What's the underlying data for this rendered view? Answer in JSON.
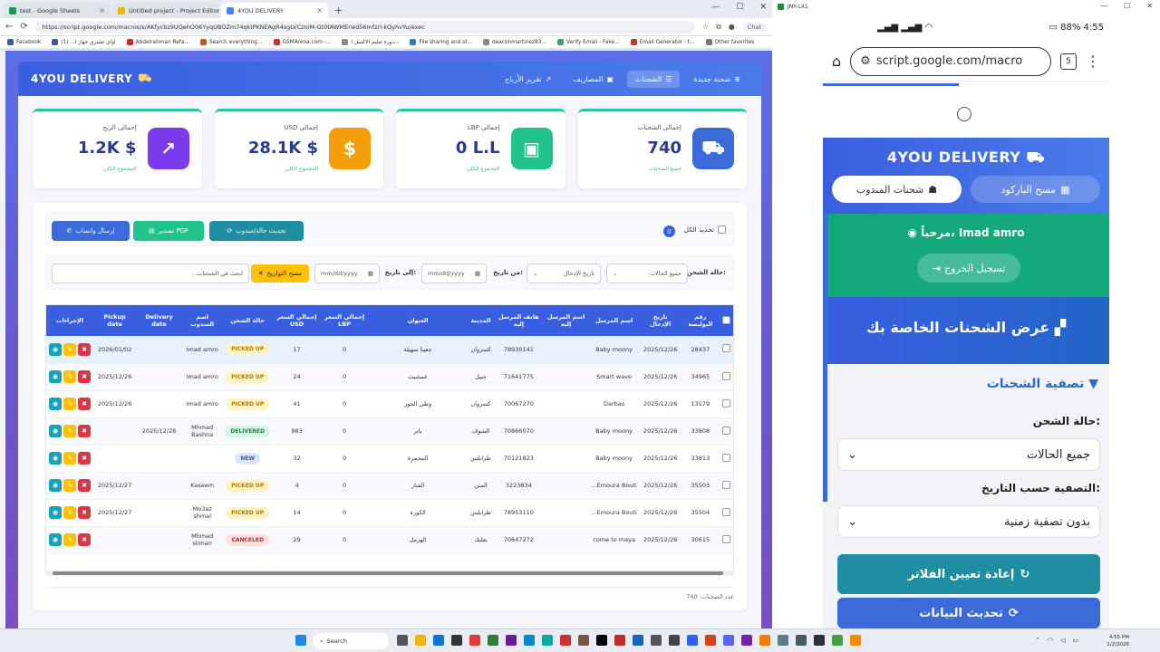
{
  "browser": {
    "tabs": [
      {
        "label": "test - Google Sheets",
        "color": "#0f9d58"
      },
      {
        "label": "Untitled project - Project Editor - A",
        "color": "#f4b400"
      },
      {
        "label": "4YOU DELIVERY",
        "color": "#4285f4"
      }
    ],
    "url": "https://script.google.com/macros/s/AKfycbz9UQehO06YyqUBOZm74qkIPKNEAgR4sgLVCzniM-Gt0tAWMErwd56mfzrl-kQyhvYu/exec",
    "chat": "Chat",
    "bookmarks": [
      "Facebook",
      "اواي تشتري جهاز ا... (1)",
      "Abdelrahman Refa...",
      "Search everything...",
      "GSMArena.com -...",
      "دورة تعليم الاكسل ا...",
      "File sharing and st...",
      "deaconmartinez83...",
      "Verify Email - Fake...",
      "Email Generator - t...",
      "Other favorites"
    ]
  },
  "app": {
    "brand": "4YOU DELIVERY",
    "nav": [
      {
        "label": "شحنة جديدة",
        "icon": "plus-circle-icon"
      },
      {
        "label": "الشحنات",
        "icon": "list-icon"
      },
      {
        "label": "المصاريف",
        "icon": "money-icon"
      },
      {
        "label": "تقرير الأرباح",
        "icon": "chart-icon"
      }
    ],
    "cards": [
      {
        "title": "إجمالي الشحنات",
        "value": "740",
        "sub": "جميع الشحنات",
        "color": "#3a6bd8",
        "glyph": "⛟"
      },
      {
        "title": "إجمالي LBP",
        "value": "0 L.L",
        "sub": "المجموع الكلي",
        "color": "#22c28b",
        "glyph": "▣"
      },
      {
        "title": "إجمالي USD",
        "value": "28.1K $",
        "sub": "المجموع الكلي",
        "color": "#f59e0b",
        "glyph": "$"
      },
      {
        "title": "إجمالي الربح",
        "value": "1.2K $",
        "sub": "المجموع الكلي",
        "color": "#7c3aed",
        "glyph": "↗"
      }
    ],
    "actions": {
      "select_all": "تحديد الكل",
      "selected_count": "0",
      "update_status": "تحديث حالة/مندوب",
      "export_pdf": "تصدير PDF",
      "send_whatsapp": "إرسال واتساب"
    },
    "filters": {
      "status_label": "حالة الشحن:",
      "status_value": "جميع الحالات",
      "date_type_value": "تاريخ الإدخال",
      "from_label": "من تاريخ:",
      "from_placeholder": "mm/dd/yyyy",
      "to_label": "إلى تاريخ:",
      "to_placeholder": "mm/dd/yyyy",
      "clear_dates": "مسح التواريخ",
      "search_placeholder": "ابحث في الشحنات..."
    },
    "table": {
      "headers": [
        "رقم البوليصة",
        "تاريخ الإدخال",
        "اسم المرسل",
        "اسم المرسل إليه",
        "هاتف المرسل إليه",
        "المدينة",
        "العنوان",
        "إجمالي السعر LBP",
        "إجمالي السعر USD",
        "حالة الشحن",
        "اسم المندوب",
        "Delivery date",
        "Pickup date",
        "الإجراءات"
      ],
      "rows": [
        {
          "id": "28437",
          "date": "2025/12/26",
          "sender": "Baby moony",
          "recipient": "",
          "phone": "78930141",
          "city": "كسروان",
          "address": "جعيتا سهيلة",
          "lbp": "0",
          "usd": "17",
          "status": "PICKED UP",
          "status_class": "st-picked",
          "agent": "Imad amro",
          "delivery": "",
          "pickup": "2026/01/02"
        },
        {
          "id": "34965",
          "date": "2025/12/26",
          "sender": "Smart wave",
          "recipient": "",
          "phone": "71641775",
          "city": "جبيل",
          "address": "عمشيت",
          "lbp": "0",
          "usd": "24",
          "status": "PICKED UP",
          "status_class": "st-picked",
          "agent": "Imad amro",
          "delivery": "",
          "pickup": "2025/12/26"
        },
        {
          "id": "13179",
          "date": "2025/12/26",
          "sender": "Darbas",
          "recipient": "",
          "phone": "70067270",
          "city": "كسروان",
          "address": "وطى الجوز",
          "lbp": "0",
          "usd": "41",
          "status": "PICKED UP",
          "status_class": "st-picked",
          "agent": "Imad amro",
          "delivery": "",
          "pickup": "2025/12/26"
        },
        {
          "id": "33808",
          "date": "2025/12/26",
          "sender": "Baby moony",
          "recipient": "",
          "phone": "70866070",
          "city": "الشوف",
          "address": "باتر",
          "lbp": "0",
          "usd": "983",
          "status": "DELIVERED",
          "status_class": "st-del",
          "agent": "Mhmad Bashna",
          "delivery": "2025/12/28",
          "pickup": ""
        },
        {
          "id": "33813",
          "date": "2025/12/26",
          "sender": "Baby moony",
          "recipient": "",
          "phone": "70121823",
          "city": "طرابلس",
          "address": "المحمرة",
          "lbp": "0",
          "usd": "32",
          "status": "NEW",
          "status_class": "st-new",
          "agent": "",
          "delivery": "",
          "pickup": ""
        },
        {
          "id": "35503",
          "date": "2025/12/26",
          "sender": "Emoura Bouti...",
          "recipient": "",
          "phone": "3223834",
          "city": "المتن",
          "address": "الفنار",
          "lbp": "0",
          "usd": "4",
          "status": "PICKED UP",
          "status_class": "st-picked",
          "agent": "Kaseem",
          "delivery": "",
          "pickup": "2025/12/27"
        },
        {
          "id": "35504",
          "date": "2025/12/26",
          "sender": "Emoura Bouti...",
          "recipient": "",
          "phone": "78953110",
          "city": "طرابلس",
          "address": "الكورة",
          "lbp": "0",
          "usd": "14",
          "status": "PICKED UP",
          "status_class": "st-picked",
          "agent": "Mo3az shmal",
          "delivery": "",
          "pickup": "2025/12/27"
        },
        {
          "id": "30615",
          "date": "2025/12/26",
          "sender": "come to maya",
          "recipient": "",
          "phone": "70647272",
          "city": "بعلبك",
          "address": "الهرمل",
          "lbp": "0",
          "usd": "29",
          "status": "CANCELED",
          "status_class": "st-can",
          "agent": "Mhmad sliman",
          "delivery": "",
          "pickup": ""
        }
      ]
    },
    "footer": "عدد الشحنات: 740"
  },
  "mobile": {
    "window_title": "JNY-LX1",
    "status_time": "4:55",
    "battery": "88%",
    "url": "script.google.com/macro",
    "tab_count": "5",
    "brand": "4YOU DELIVERY",
    "btn_barcode": "مسح الباركود",
    "btn_agent": "شحنات المندوب",
    "welcome": "مرحباً، Imad amro",
    "logout": "تسجيل الخروج",
    "heading": "عرض الشحنات الخاصة بك",
    "filter_title": "تصفية الشحنات",
    "status_label": "حالة الشحن:",
    "status_value": "جميع الحالات",
    "date_label": "التصفية حسب التاريخ:",
    "date_value": "بدون تصفية زمنية",
    "reset": "إعادة تعيين الفلاتر",
    "refresh": "تحديث البيانات"
  },
  "taskbar": {
    "search": "Search",
    "time": "4:55 PM",
    "date": "1/2/2026"
  }
}
